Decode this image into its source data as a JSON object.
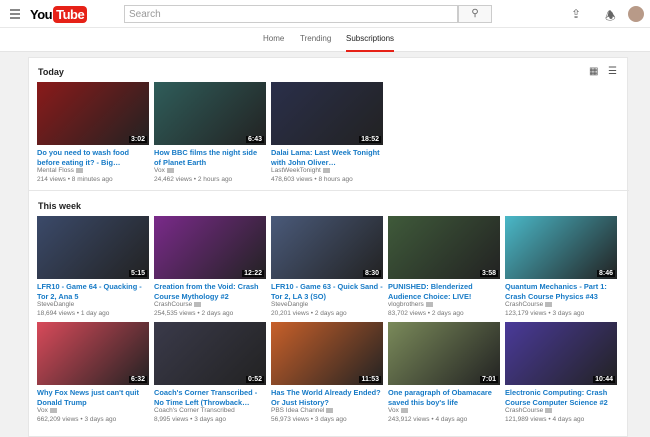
{
  "header": {
    "logo_you": "You",
    "logo_tube": "Tube",
    "search_placeholder": "Search"
  },
  "tabs": [
    {
      "label": "Home"
    },
    {
      "label": "Trending"
    },
    {
      "label": "Subscriptions",
      "active": true
    }
  ],
  "sections": [
    {
      "title": "Today",
      "videos": [
        {
          "title": "Do you need to wash food before eating it? - Big…",
          "channel": "Mental Floss",
          "views": "214 views",
          "age": "8 minutes ago",
          "duration": "3:02",
          "color": "#8a1a1a",
          "verified": true
        },
        {
          "title": "How BBC films the night side of Planet Earth",
          "channel": "Vox",
          "views": "24,462 views",
          "age": "2 hours ago",
          "duration": "6:43",
          "color": "#2f5d5a",
          "verified": true
        },
        {
          "title": "Dalai Lama: Last Week Tonight with John Oliver…",
          "channel": "LastWeekTonight",
          "views": "478,603 views",
          "age": "8 hours ago",
          "duration": "18:52",
          "color": "#2a2f4a",
          "verified": true
        }
      ]
    },
    {
      "title": "This week",
      "videos": [
        {
          "title": "LFR10 - Game 64 - Quacking - Tor 2, Ana 5",
          "channel": "SteveDangle",
          "views": "18,694 views",
          "age": "1 day ago",
          "duration": "5:15",
          "color": "#3b4a6a",
          "verified": false
        },
        {
          "title": "Creation from the Void: Crash Course Mythology #2",
          "channel": "CrashCourse",
          "views": "254,535 views",
          "age": "2 days ago",
          "duration": "12:22",
          "color": "#7a2a8a",
          "verified": true
        },
        {
          "title": "LFR10 - Game 63 - Quick Sand - Tor 2, LA 3 (SO)",
          "channel": "SteveDangle",
          "views": "20,201 views",
          "age": "2 days ago",
          "duration": "8:30",
          "color": "#4a5a7a",
          "verified": false
        },
        {
          "title": "PUNISHED: Blenderized Audience Choice: LIVE!",
          "channel": "vlogbrothers",
          "views": "83,702 views",
          "age": "2 days ago",
          "duration": "3:58",
          "color": "#3f5a3a",
          "verified": true
        },
        {
          "title": "Quantum Mechanics - Part 1: Crash Course Physics #43",
          "channel": "CrashCourse",
          "views": "123,179 views",
          "age": "3 days ago",
          "duration": "8:46",
          "color": "#4ab8c8",
          "verified": true
        },
        {
          "title": "Why Fox News just can't quit Donald Trump",
          "channel": "Vox",
          "views": "662,209 views",
          "age": "3 days ago",
          "duration": "6:32",
          "color": "#d84a5a",
          "verified": true
        },
        {
          "title": "Coach's Corner Transcribed - No Time Left (Throwback…",
          "channel": "Coach's Corner Transcribed",
          "views": "8,995 views",
          "age": "3 days ago",
          "duration": "0:52",
          "color": "#3a3a4a",
          "verified": false
        },
        {
          "title": "Has The World Already Ended? Or Just History?",
          "channel": "PBS Idea Channel",
          "views": "56,973 views",
          "age": "3 days ago",
          "duration": "11:53",
          "color": "#c8602a",
          "verified": true
        },
        {
          "title": "One paragraph of Obamacare saved this boy's life",
          "channel": "Vox",
          "views": "243,912 views",
          "age": "4 days ago",
          "duration": "7:01",
          "color": "#7a8a5a",
          "verified": true
        },
        {
          "title": "Electronic Computing: Crash Course Computer Science #2",
          "channel": "CrashCourse",
          "views": "121,989 views",
          "age": "4 days ago",
          "duration": "10:44",
          "color": "#4a3a9a",
          "verified": true
        }
      ]
    }
  ]
}
